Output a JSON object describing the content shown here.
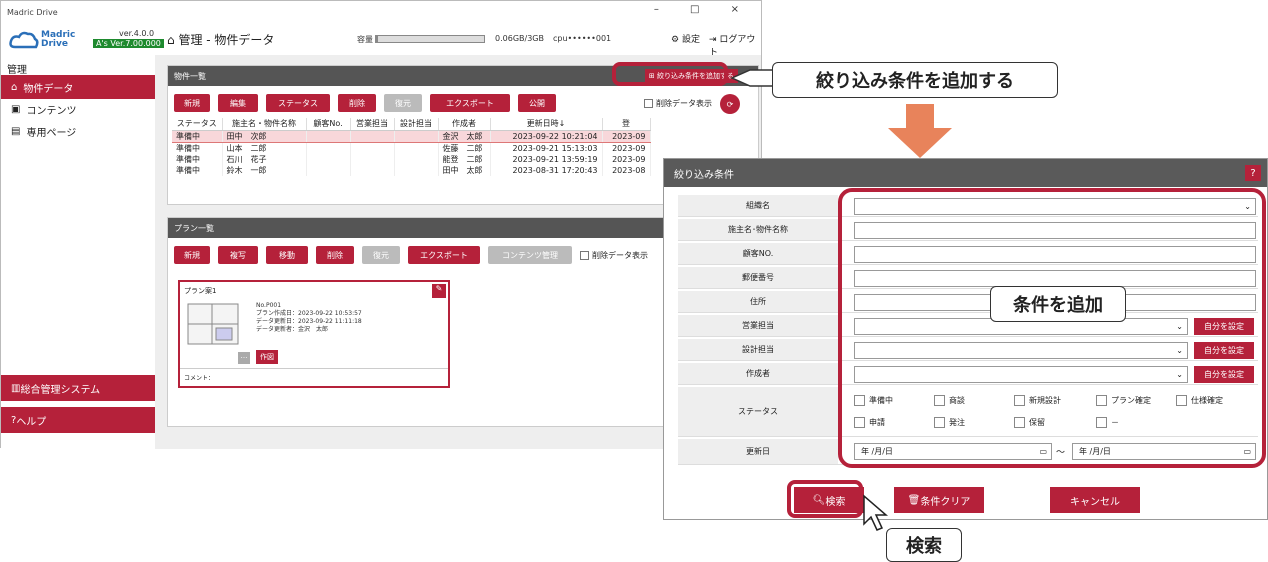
{
  "window": {
    "title": "Madric Drive",
    "controls": "– □ ×"
  },
  "app": {
    "logo_line1": "Madric",
    "logo_line2": "Drive",
    "version": "ver.4.0.0",
    "as_version": "A's Ver.7.00.000",
    "breadcrumb": "管理 - 物件データ",
    "capacity_label": "容量",
    "capacity_text": "0.06GB/3GB",
    "capacity_fraction": 0.02,
    "cpu": "cpu••••••001",
    "settings": "設定",
    "logout": "ログアウト"
  },
  "sidebar": {
    "header": "管理",
    "items": [
      {
        "label": "物件データ",
        "icon": "home-icon",
        "active": true
      },
      {
        "label": "コンテンツ",
        "icon": "image-icon",
        "active": false
      },
      {
        "label": "専用ページ",
        "icon": "page-icon",
        "active": false
      }
    ],
    "bottom": [
      {
        "label": "総合管理システム"
      },
      {
        "label": "ヘルプ"
      }
    ]
  },
  "props": {
    "title": "物件一覧",
    "add_filter": "絞り込み条件を追加する",
    "toolbar": [
      "新規",
      "編集",
      "ステータス",
      "削除",
      "復元",
      "エクスポート",
      "公開"
    ],
    "show_deleted": "削除データ表示",
    "columns": [
      "ステータス",
      "施主名・物件名称",
      "顧客No.",
      "営業担当",
      "設計担当",
      "作成者",
      "更新日時↓",
      "登"
    ],
    "rows": [
      [
        "準備中",
        "田中　次郎",
        "",
        "",
        "",
        "金沢　太郎",
        "2023-09-22 10:21:04",
        "2023-09"
      ],
      [
        "準備中",
        "山本　二郎",
        "",
        "",
        "",
        "佐藤　二郎",
        "2023-09-21 15:13:03",
        "2023-09"
      ],
      [
        "準備中",
        "石川　花子",
        "",
        "",
        "",
        "能登　二郎",
        "2023-09-21 13:59:19",
        "2023-09"
      ],
      [
        "準備中",
        "鈴木　一郎",
        "",
        "",
        "",
        "田中　太郎",
        "2023-08-31 17:20:43",
        "2023-08"
      ]
    ]
  },
  "plans": {
    "title": "プラン一覧",
    "toolbar": [
      "新規",
      "複写",
      "移動",
      "削除",
      "復元",
      "エクスポート",
      "コンテンツ管理"
    ],
    "show_deleted": "削除データ表示",
    "card": {
      "name": "プラン案1",
      "no": "No.P001",
      "created": "プラン作成日：2023-09-22 10:53:57",
      "updated": "データ更新日：2023-09-22 11:11:18",
      "updater": "データ更新者：金沢　太郎",
      "draw": "作図",
      "comment": "コメント："
    }
  },
  "dialog": {
    "title": "絞り込み条件",
    "help": "?",
    "fields": [
      "組織名",
      "施主名･物件名称",
      "顧客NO.",
      "郵便番号",
      "住所",
      "営業担当",
      "設計担当",
      "作成者",
      "ステータス",
      "更新日"
    ],
    "self_btn": "自分を設定",
    "statuses": [
      "準備中",
      "商談",
      "新規設計",
      "プラン確定",
      "仕様確定",
      "申請",
      "発注",
      "保留",
      "－"
    ],
    "date_placeholder": "年 /月/日",
    "tilde": "～",
    "search": "検索",
    "clear": "条件クリア",
    "cancel": "キャンセル"
  },
  "annotations": {
    "add_filter": "絞り込み条件を追加する",
    "add_cond": "条件を追加",
    "search": "検索"
  },
  "colors": {
    "accent": "#b5213a",
    "arrow": "#e8835b"
  }
}
